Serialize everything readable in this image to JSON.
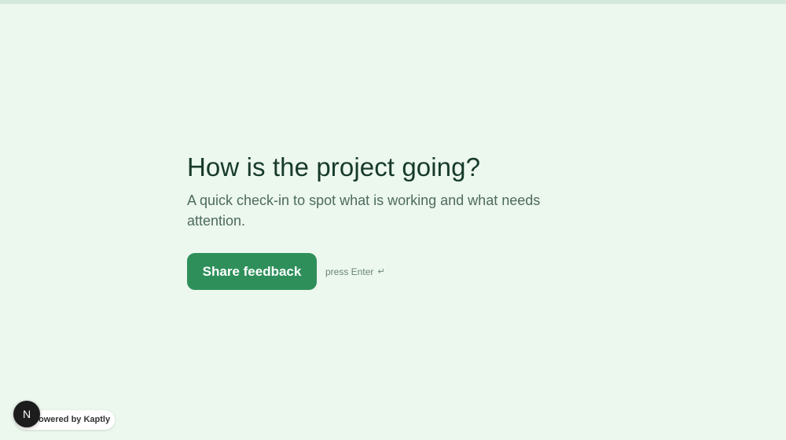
{
  "progress": {
    "value": 0
  },
  "main": {
    "title": "How is the project going?",
    "subtitle": "A quick check-in to spot what is working and what needs attention.",
    "cta_label": "Share feedback",
    "hint_text": "press Enter",
    "hint_icon": "↵"
  },
  "badge": {
    "text": "owered by Kaptly"
  },
  "dev_indicator": {
    "letter": "N"
  },
  "colors": {
    "background": "#ecf7ee",
    "accent": "#2e8f5b",
    "title": "#163a2a"
  }
}
